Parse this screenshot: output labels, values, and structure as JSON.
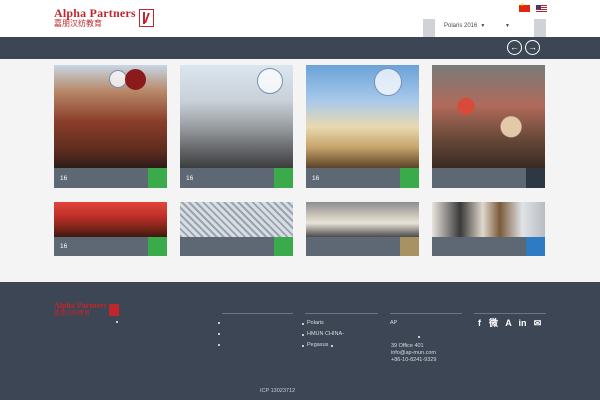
{
  "header": {
    "logo_text": "Alpha Partners",
    "logo_cn": "嘉朋汉纺教育",
    "dropdown_label": "Polaris 2016",
    "dropdown2_label": ""
  },
  "language_flags": [
    "flag-cn",
    "flag-us"
  ],
  "nav": {
    "prev_icon": "arrow-left-circle-icon",
    "next_icon": "arrow-right-circle-icon",
    "prev_symbol": "←",
    "next_symbol": "→"
  },
  "cards": [
    {
      "label": "16",
      "accent": "#3aaa4b",
      "image": "harvard-building-photo"
    },
    {
      "label": "16",
      "accent": "#3aaa4b",
      "image": "un-building-photo"
    },
    {
      "label": "16",
      "accent": "#3aaa4b",
      "image": "capitol-photo"
    },
    {
      "label": "",
      "accent": "#2e3744",
      "image": "group-photo"
    },
    {
      "label": "16",
      "accent": "#3aaa4b",
      "image": "conference-hall-photo"
    },
    {
      "label": "",
      "accent": "#3aaa4b",
      "image": "birds-nest-photo"
    },
    {
      "label": "",
      "accent": "#a89263",
      "image": "classroom-photo"
    },
    {
      "label": "",
      "accent": "#2e7bc4",
      "image": "students-photo"
    }
  ],
  "footer": {
    "logo_text": "Alpha Partners",
    "logo_cn": "嘉朋汉纺教育",
    "col2_items": [
      "Polaris",
      "HMUN CHINA-",
      "Pegasus"
    ],
    "address_label": "AP",
    "address_lines": [
      "39 Office 401",
      "info@ap-mun.com",
      "+86-10-8241-9329"
    ],
    "social": [
      "f",
      "微",
      "A",
      "in",
      "✉"
    ],
    "icp": "ICP 13023712"
  },
  "colors": {
    "nav_bg": "#3c4654",
    "brand_red": "#c0272d",
    "card_bar": "#5e6774",
    "green": "#3aaa4b"
  }
}
